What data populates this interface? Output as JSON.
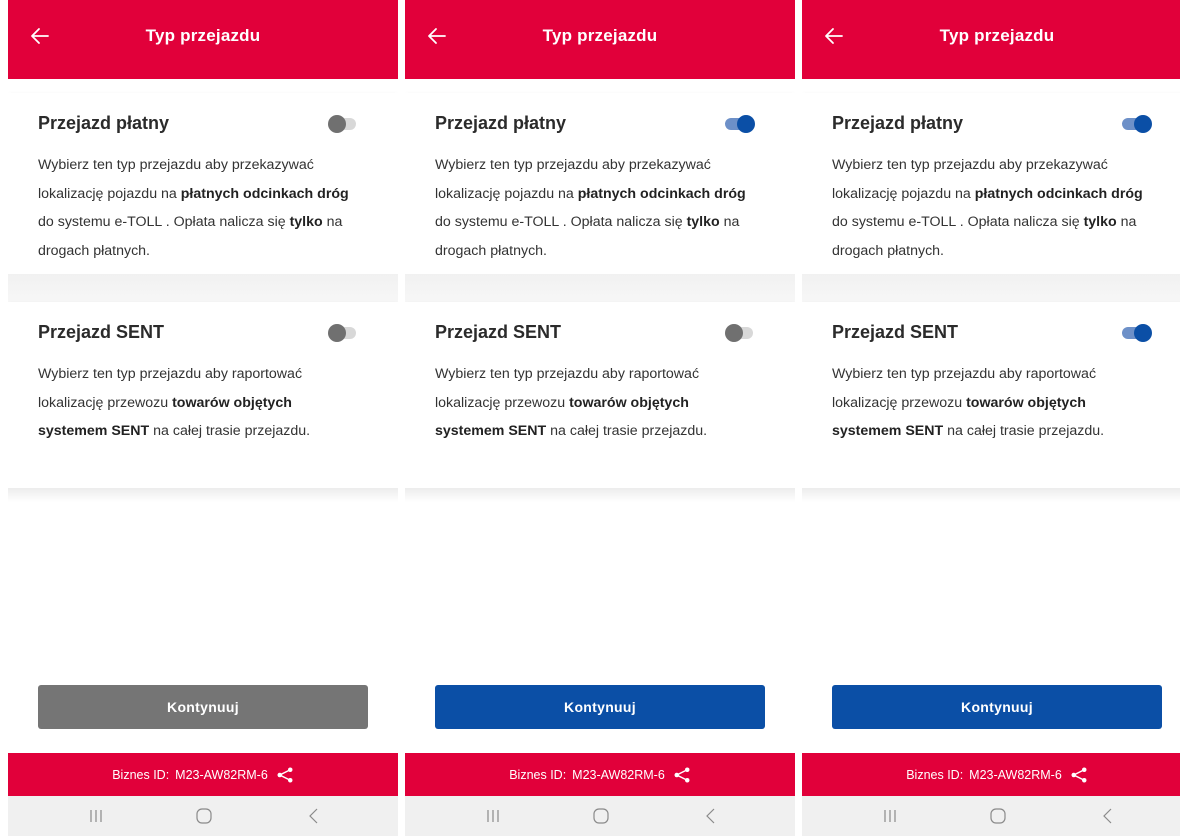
{
  "screens": [
    {
      "title": "Typ przejazdu",
      "cards": [
        {
          "title": "Przejazd płatny",
          "toggle_on": false,
          "desc": [
            {
              "t": "Wybierz ten typ przejazdu aby przekazywać lokalizację pojazdu na ",
              "b": false
            },
            {
              "t": "płatnych odcinkach dróg",
              "b": true
            },
            {
              "t": " do systemu e-TOLL . Opłata nalicza się ",
              "b": false
            },
            {
              "t": "tylko",
              "b": true
            },
            {
              "t": " na drogach płatnych.",
              "b": false
            }
          ]
        },
        {
          "title": "Przejazd SENT",
          "toggle_on": false,
          "desc": [
            {
              "t": "Wybierz ten typ przejazdu aby raportować lokalizację przewozu ",
              "b": false
            },
            {
              "t": "towarów objętych systemem SENT",
              "b": true
            },
            {
              "t": " na całej trasie przejazdu.",
              "b": false
            }
          ]
        }
      ],
      "button": {
        "label": "Kontynuuj",
        "enabled": false
      },
      "footer": {
        "label": "Biznes ID:",
        "id": "M23-AW82RM-6"
      }
    },
    {
      "title": "Typ przejazdu",
      "cards": [
        {
          "title": "Przejazd płatny",
          "toggle_on": true,
          "desc": [
            {
              "t": "Wybierz ten typ przejazdu aby przekazywać lokalizację pojazdu na ",
              "b": false
            },
            {
              "t": "płatnych odcinkach dróg",
              "b": true
            },
            {
              "t": " do systemu e-TOLL . Opłata nalicza się ",
              "b": false
            },
            {
              "t": "tylko",
              "b": true
            },
            {
              "t": " na drogach płatnych.",
              "b": false
            }
          ]
        },
        {
          "title": "Przejazd SENT",
          "toggle_on": false,
          "desc": [
            {
              "t": "Wybierz ten typ przejazdu aby raportować lokalizację przewozu ",
              "b": false
            },
            {
              "t": "towarów objętych systemem SENT",
              "b": true
            },
            {
              "t": " na całej trasie przejazdu.",
              "b": false
            }
          ]
        }
      ],
      "button": {
        "label": "Kontynuuj",
        "enabled": true
      },
      "footer": {
        "label": "Biznes ID:",
        "id": "M23-AW82RM-6"
      }
    },
    {
      "title": "Typ przejazdu",
      "cards": [
        {
          "title": "Przejazd płatny",
          "toggle_on": true,
          "desc": [
            {
              "t": "Wybierz ten typ przejazdu aby przekazywać lokalizację pojazdu na ",
              "b": false
            },
            {
              "t": "płatnych odcinkach dróg",
              "b": true
            },
            {
              "t": " do systemu e-TOLL . Opłata nalicza się ",
              "b": false
            },
            {
              "t": "tylko",
              "b": true
            },
            {
              "t": " na drogach płatnych.",
              "b": false
            }
          ]
        },
        {
          "title": "Przejazd SENT",
          "toggle_on": true,
          "desc": [
            {
              "t": "Wybierz ten typ przejazdu aby raportować lokalizację przewozu ",
              "b": false
            },
            {
              "t": "towarów objętych systemem SENT",
              "b": true
            },
            {
              "t": " na całej trasie przejazdu.",
              "b": false
            }
          ]
        }
      ],
      "button": {
        "label": "Kontynuuj",
        "enabled": true
      },
      "footer": {
        "label": "Biznes ID:",
        "id": "M23-AW82RM-6"
      }
    }
  ],
  "icons": {
    "back": "arrow-left-icon",
    "share": "share-icon",
    "nav_recent": "recent-apps-icon",
    "nav_home": "home-icon",
    "nav_back": "chevron-left-icon"
  },
  "colors": {
    "brand_red": "#e1003a",
    "primary_blue": "#0b4fa6",
    "disabled_gray": "#757575"
  }
}
